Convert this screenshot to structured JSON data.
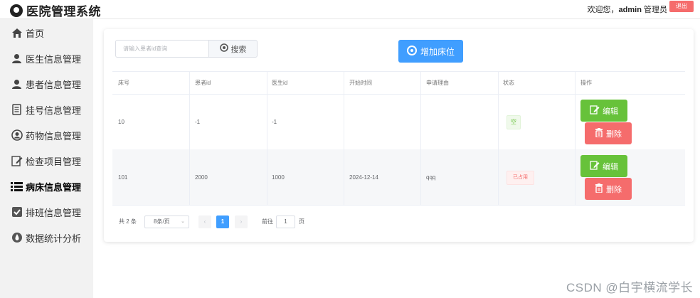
{
  "app": {
    "title": "医院管理系统"
  },
  "header": {
    "welcome_prefix": "欢迎您，",
    "username": "admin",
    "role": "管理员",
    "logout_label": "退出"
  },
  "sidebar": {
    "items": [
      {
        "label": "首页",
        "icon": "home-icon"
      },
      {
        "label": "医生信息管理",
        "icon": "user-icon"
      },
      {
        "label": "患者信息管理",
        "icon": "user-icon"
      },
      {
        "label": "挂号信息管理",
        "icon": "document-icon"
      },
      {
        "label": "药物信息管理",
        "icon": "user-circle-icon"
      },
      {
        "label": "检查项目管理",
        "icon": "edit-icon"
      },
      {
        "label": "病床信息管理",
        "icon": "list-icon",
        "active": true
      },
      {
        "label": "排班信息管理",
        "icon": "check-square-icon"
      },
      {
        "label": "数据统计分析",
        "icon": "drop-icon"
      }
    ]
  },
  "toolbar": {
    "search_placeholder": "请输入患者id查询",
    "search_label": "搜索",
    "add_label": "增加床位"
  },
  "table": {
    "headers": [
      "床号",
      "患者id",
      "医生id",
      "开始时间",
      "申请理由",
      "状态",
      "操作"
    ],
    "rows": [
      {
        "bed": "10",
        "patient_id": "-1",
        "doctor_id": "-1",
        "start_time": "",
        "reason": "",
        "status": "空",
        "status_type": "empty"
      },
      {
        "bed": "101",
        "patient_id": "2000",
        "doctor_id": "1000",
        "start_time": "2024-12-14",
        "reason": "qqq",
        "status": "已占用",
        "status_type": "used"
      }
    ],
    "edit_label": "编辑",
    "delete_label": "删除"
  },
  "pagination": {
    "total": "共 2 条",
    "page_size": "8条/页",
    "current_page": "1",
    "goto_label": "前往",
    "goto_value": "1",
    "page_label": "页"
  },
  "watermark": "CSDN @白宇横流学长",
  "colors": {
    "primary": "#409eff",
    "success": "#67c23a",
    "danger": "#f56c6c"
  }
}
